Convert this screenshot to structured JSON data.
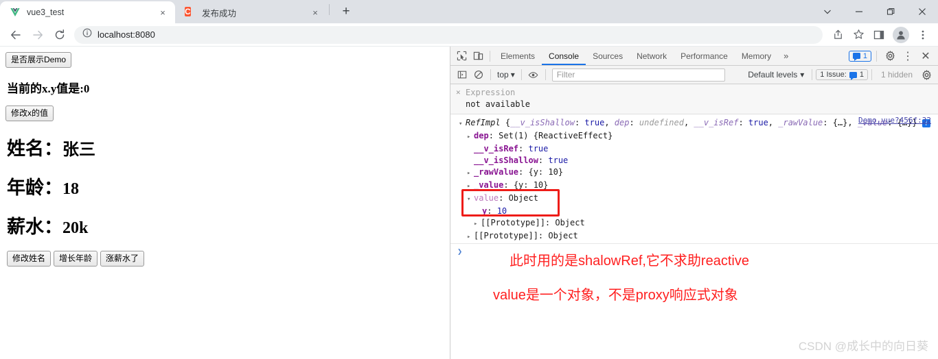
{
  "browser": {
    "tabs": [
      {
        "title": "vue3_test",
        "favicon": "vue-logo-icon",
        "active": true,
        "close_label": "×"
      },
      {
        "title": "发布成功",
        "favicon": "csdn-logo-icon",
        "favicon_text": "C",
        "active": false,
        "close_label": "×"
      }
    ],
    "new_tab_label": "+",
    "window_controls": [
      {
        "name": "tab-search-button",
        "glyph": "⌵"
      },
      {
        "name": "minimize-button",
        "glyph": "−"
      },
      {
        "name": "maximize-button",
        "glyph": "❐"
      },
      {
        "name": "close-window-button",
        "glyph": "✕"
      }
    ],
    "toolbar": {
      "back_label": "←",
      "forward_label": "→",
      "reload_label": "⟳",
      "site_info_label": "ⓘ",
      "url": "localhost:8080",
      "share_label": "share-icon",
      "bookmark_label": "☆",
      "side_panel_label": "side-panel-icon",
      "profile_label": "profile-avatar-icon",
      "menu_label": "⋮"
    }
  },
  "page": {
    "demo_toggle_button": "是否展示Demo",
    "xy_text": "当前的x.y值是:0",
    "modify_x_button": "修改x的值",
    "fields": [
      {
        "label": "姓名：",
        "value": "张三"
      },
      {
        "label": "年龄：",
        "value": "18"
      },
      {
        "label": "薪水：",
        "value": "20k"
      }
    ],
    "action_buttons": [
      "修改姓名",
      "增长年龄",
      "涨薪水了"
    ]
  },
  "devtools": {
    "tabs": [
      {
        "label": "Elements",
        "selected": false
      },
      {
        "label": "Console",
        "selected": true
      },
      {
        "label": "Sources",
        "selected": false
      },
      {
        "label": "Network",
        "selected": false
      },
      {
        "label": "Performance",
        "selected": false
      },
      {
        "label": "Memory",
        "selected": false
      }
    ],
    "more_tabs_label": "»",
    "inspect_icon": "inspect-element-icon",
    "device_toolbar_icon": "device-toolbar-icon",
    "message_count": "1",
    "settings_icon": "gear-icon",
    "kebab_icon": "⋮",
    "close_icon": "✕",
    "filterbar": {
      "sidebar_toggle_icon": "console-sidebar-icon",
      "clear_icon": "clear-console-icon",
      "context": "top",
      "context_caret": "▾",
      "eye_icon": "live-expression-icon",
      "filter_placeholder": "Filter",
      "levels_label": "Default levels",
      "levels_caret": "▾",
      "issues_label": "1 Issue:",
      "issues_count": "1",
      "hidden_label": "1 hidden",
      "settings_icon": "gear-icon"
    },
    "live_expression": {
      "close_glyph": "✕",
      "label": "Expression",
      "value": "not available"
    },
    "log": {
      "source_link": "Demo.vue?456f:32",
      "header": {
        "caret": "▾",
        "ctor": "RefImpl",
        "open_brace": "{",
        "props": [
          {
            "key": "__v_isShallow",
            "value": "true",
            "kind": "bool"
          },
          {
            "key": "dep",
            "value": "undefined",
            "kind": "undefined"
          },
          {
            "key": "__v_isRef",
            "value": "true",
            "kind": "bool"
          },
          {
            "key": "_rawValue",
            "value": "{…}",
            "kind": "object"
          },
          {
            "key": "_value",
            "value": "{…}",
            "kind": "object"
          }
        ],
        "close_brace": "}",
        "info_badge": "i"
      },
      "rows": [
        {
          "indent": 1,
          "caret": "▸",
          "key": "dep",
          "sep": ": ",
          "value": "Set(1) {ReactiveEffect}",
          "kind": "object",
          "bold_key": true
        },
        {
          "indent": 2,
          "caret": "",
          "key": "__v_isRef",
          "sep": ": ",
          "value": "true",
          "kind": "bool"
        },
        {
          "indent": 2,
          "caret": "",
          "key": "__v_isShallow",
          "sep": ": ",
          "value": "true",
          "kind": "bool"
        },
        {
          "indent": 1,
          "caret": "▸",
          "key": "_rawValue",
          "sep": ": ",
          "value": "{y: 10}",
          "kind": "object",
          "bold_key": true
        },
        {
          "indent": 1,
          "caret": "▸",
          "key": "_value",
          "sep": ": ",
          "value": "{y: 10}",
          "kind": "object",
          "bold_key": true
        },
        {
          "indent": 1,
          "caret": "▾",
          "key": "value",
          "sep": ": ",
          "value": "Object",
          "kind": "object",
          "muted_key": true
        },
        {
          "indent": 3,
          "caret": "",
          "key": "y",
          "sep": ": ",
          "value": "10",
          "kind": "number"
        },
        {
          "indent": 2,
          "caret": "▸",
          "key": "[[Prototype]]",
          "sep": ": ",
          "value": "Object",
          "kind": "plain"
        },
        {
          "indent": 1,
          "caret": "▸",
          "key": "[[Prototype]]",
          "sep": ": ",
          "value": "Object",
          "kind": "plain"
        }
      ],
      "prompt_glyph": "❯"
    },
    "annotations": {
      "highlight_color": "#ee1c18",
      "text_color": "#ff1f1f",
      "line1": "此时用的是shalowRef,它不求助reactive",
      "line2": "value是一个对象，不是proxy响应式对象"
    },
    "watermark": "CSDN @成长中的向日葵"
  }
}
